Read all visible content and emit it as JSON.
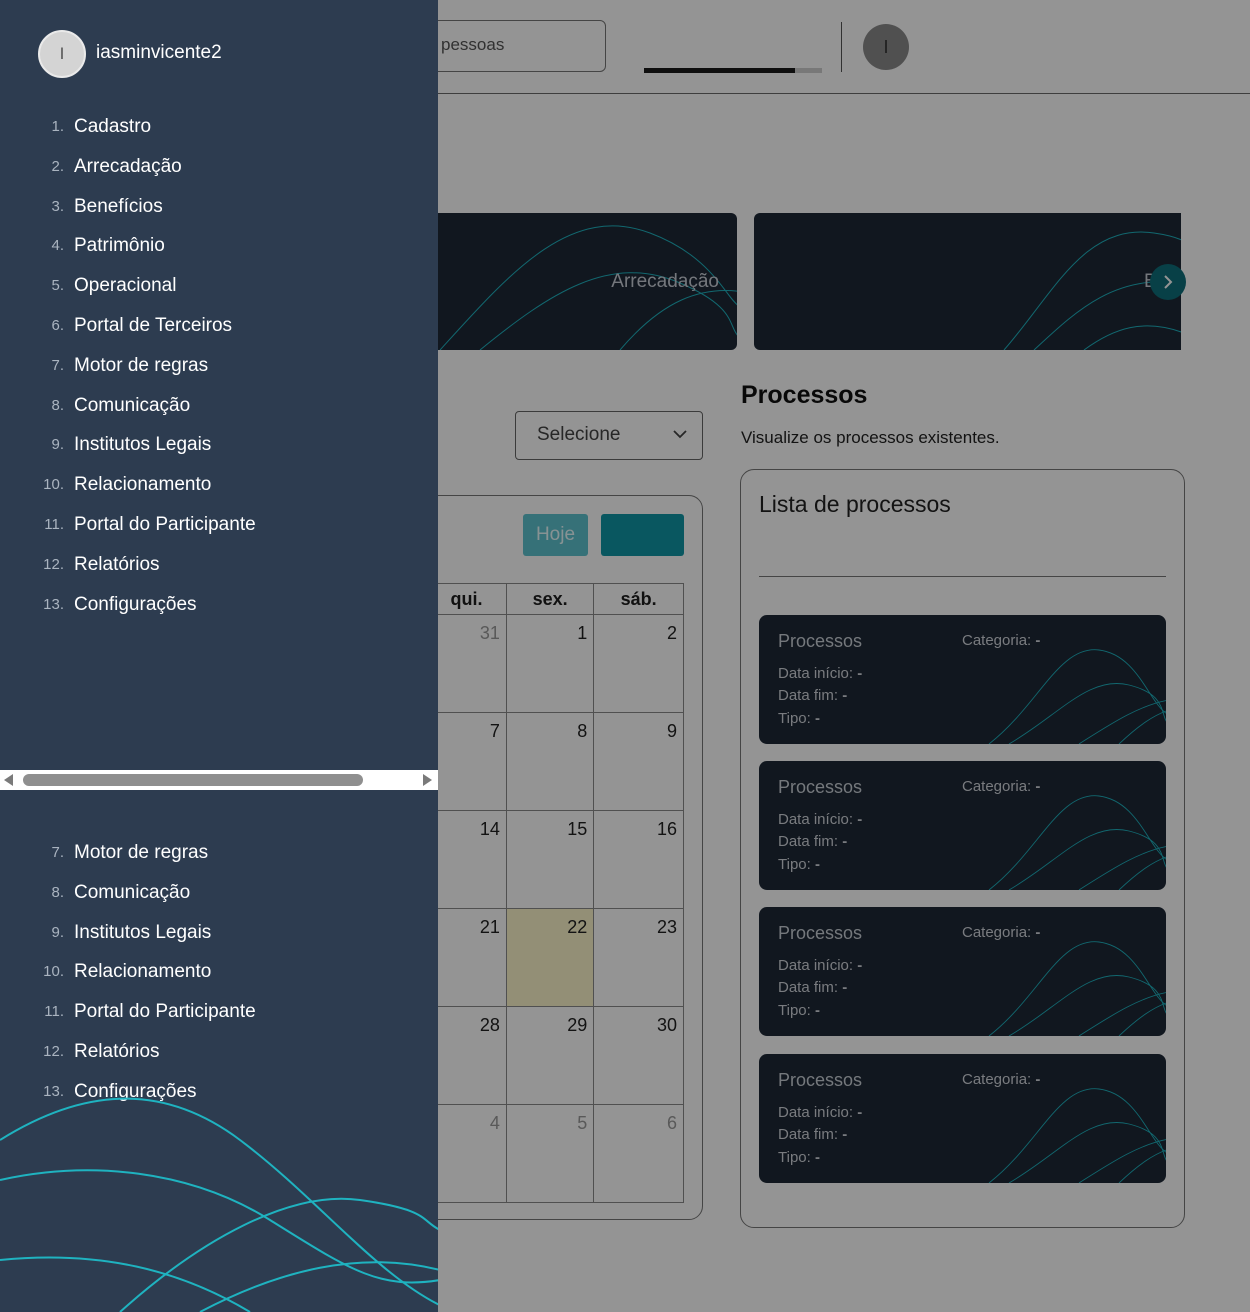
{
  "colors": {
    "drawer_bg": "#2d3c50",
    "card_bg": "#1e2836",
    "accent_teal": "#1097a6",
    "hoje_button": "#5ec3cf",
    "today_cell": "#fdf7cc",
    "wave_stroke": "#1fb3c0"
  },
  "header": {
    "search_value": "pessoas",
    "avatar_initial": "I",
    "progress_fraction": 0.85
  },
  "banners": [
    {
      "label": "Arrecadação"
    },
    {
      "label": "B"
    }
  ],
  "icons": {
    "carousel_next": "chevron-right-icon",
    "select_chevron": "chevron-down-icon"
  },
  "filter": {
    "select_value": "Selecione"
  },
  "calendar": {
    "today_button": "Hoje",
    "weekday_headers": [
      "qui.",
      "sex.",
      "sáb."
    ],
    "weeks": [
      [
        {
          "d": "31",
          "muted": true
        },
        {
          "d": "1"
        },
        {
          "d": "2"
        }
      ],
      [
        {
          "d": "7"
        },
        {
          "d": "8"
        },
        {
          "d": "9"
        }
      ],
      [
        {
          "d": "14"
        },
        {
          "d": "15"
        },
        {
          "d": "16"
        }
      ],
      [
        {
          "d": "21"
        },
        {
          "d": "22",
          "today": true
        },
        {
          "d": "23"
        }
      ],
      [
        {
          "d": "28"
        },
        {
          "d": "29"
        },
        {
          "d": "30"
        }
      ],
      [
        {
          "d": "4",
          "muted": true
        },
        {
          "d": "5",
          "muted": true
        },
        {
          "d": "6",
          "muted": true
        }
      ]
    ]
  },
  "processos": {
    "title": "Processos",
    "subtitle": "Visualize os processos existentes.",
    "list_title": "Lista de processos",
    "cards": [
      {
        "title": "Processos",
        "categoria_label": "Categoria:",
        "categoria_value": "-",
        "inicio_label": "Data início:",
        "inicio_value": "-",
        "fim_label": "Data fim:",
        "fim_value": "-",
        "tipo_label": "Tipo:",
        "tipo_value": "-"
      },
      {
        "title": "Processos",
        "categoria_label": "Categoria:",
        "categoria_value": "-",
        "inicio_label": "Data início:",
        "inicio_value": "-",
        "fim_label": "Data fim:",
        "fim_value": "-",
        "tipo_label": "Tipo:",
        "tipo_value": "-"
      },
      {
        "title": "Processos",
        "categoria_label": "Categoria:",
        "categoria_value": "-",
        "inicio_label": "Data início:",
        "inicio_value": "-",
        "fim_label": "Data fim:",
        "fim_value": "-",
        "tipo_label": "Tipo:",
        "tipo_value": "-"
      },
      {
        "title": "Processos",
        "categoria_label": "Categoria:",
        "categoria_value": "-",
        "inicio_label": "Data início:",
        "inicio_value": "-",
        "fim_label": "Data fim:",
        "fim_value": "-",
        "tipo_label": "Tipo:",
        "tipo_value": "-"
      }
    ]
  },
  "drawer": {
    "avatar_initial": "I",
    "username": "iasminvicente2",
    "menu": [
      {
        "num": "1.",
        "label": "Cadastro"
      },
      {
        "num": "2.",
        "label": "Arrecadação"
      },
      {
        "num": "3.",
        "label": "Benefícios"
      },
      {
        "num": "4.",
        "label": "Patrimônio"
      },
      {
        "num": "5.",
        "label": "Operacional"
      },
      {
        "num": "6.",
        "label": "Portal de Terceiros"
      },
      {
        "num": "7.",
        "label": "Motor de regras"
      },
      {
        "num": "8.",
        "label": "Comunicação"
      },
      {
        "num": "9.",
        "label": "Institutos Legais"
      },
      {
        "num": "10.",
        "label": "Relacionamento"
      },
      {
        "num": "11.",
        "label": "Portal do Participante"
      },
      {
        "num": "12.",
        "label": "Relatórios"
      },
      {
        "num": "13.",
        "label": "Configurações"
      }
    ],
    "menu_repeat": [
      {
        "num": "7.",
        "label": "Motor de regras"
      },
      {
        "num": "8.",
        "label": "Comunicação"
      },
      {
        "num": "9.",
        "label": "Institutos Legais"
      },
      {
        "num": "10.",
        "label": "Relacionamento"
      },
      {
        "num": "11.",
        "label": "Portal do Participante"
      },
      {
        "num": "12.",
        "label": "Relatórios"
      },
      {
        "num": "13.",
        "label": "Configurações"
      }
    ]
  }
}
